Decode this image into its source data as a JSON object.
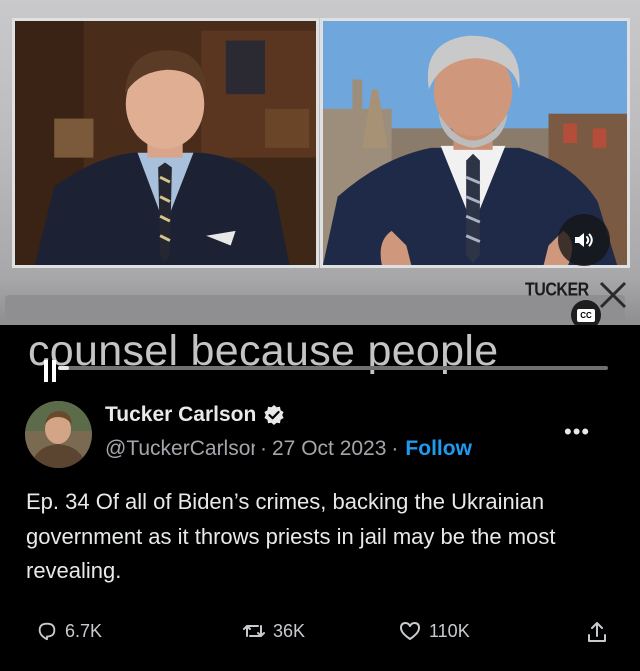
{
  "video": {
    "caption": "counsel because people",
    "watermark": "TUCKER",
    "cc_label": "CC",
    "progress": 0.02,
    "icons": [
      "speaker-icon",
      "pause-icon",
      "cc-icon"
    ]
  },
  "tweet": {
    "author_name": "Tucker Carlson",
    "verified": true,
    "handle": "@TuckerCarlson",
    "date": "27 Oct 2023",
    "separator": "·",
    "follow_label": "Follow",
    "more_label": "•••",
    "text": "Ep. 34  Of all of Biden’s crimes, backing the Ukrainian government as it throws priests in jail may be the most revealing."
  },
  "actions": {
    "replies": "6.7K",
    "reposts": "36K",
    "likes": "110K"
  },
  "colors": {
    "background": "#000000",
    "text": "#e7e9ea",
    "muted": "#a3a7ab",
    "accent": "#1d9bf0"
  }
}
